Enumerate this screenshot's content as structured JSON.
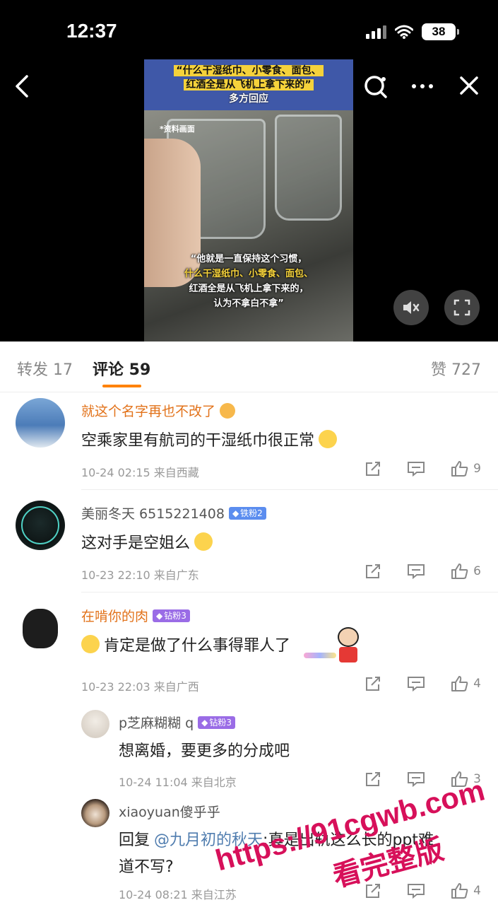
{
  "status_bar": {
    "time": "12:37",
    "battery": "38"
  },
  "video": {
    "title_lines": [
      "“什么干湿纸巾、小零食、面包、",
      "红酒全是从飞机上拿下来的”",
      "多方回应"
    ],
    "tag": "*资料画面",
    "caption_lines": [
      "“他就是一直保持这个习惯，",
      "什么干湿纸巾、小零食、面包、",
      "红酒全是从飞机上拿下来的，",
      "认为不拿白不拿”"
    ]
  },
  "tabs": {
    "repost": "转发 17",
    "comments": "评论 59",
    "likes": "赞 727"
  },
  "comments": [
    {
      "name": "就这个名字再也不改了",
      "text": "空乘家里有航司的干湿纸巾很正常",
      "meta": "10-24 02:15  来自西藏",
      "likes": "9"
    },
    {
      "name": "美丽冬天 6515221408",
      "badge": "铁粉2",
      "text": "这对手是空姐么",
      "meta": "10-23 22:10  来自广东",
      "likes": "6"
    },
    {
      "name": "在啃你的肉",
      "badge": "钻粉3",
      "text": "肯定是做了什么事得罪人了",
      "meta": "10-23 22:03  来自广西",
      "likes": "4"
    }
  ],
  "replies": [
    {
      "name": "p芝麻糊糊 q",
      "badge": "钻粉3",
      "text": "想离婚，要更多的分成吧",
      "meta": "10-24 11:04  来自北京",
      "likes": "3"
    },
    {
      "name": "xiaoyuan傻乎乎",
      "text_prefix": "回复",
      "mention": "@九月初的秋天",
      "text_rest": ":真是出轨这么长的ppt难",
      "text_line2": "道不写?",
      "meta": "10-24 08:21  来自江苏",
      "likes": "4"
    }
  ],
  "watermark": {
    "url": "https://91cgwb.com",
    "sub": "看完整版"
  },
  "colors": {
    "accent": "#ff8200",
    "name_orange": "#e2721a",
    "watermark": "#d7105a"
  }
}
